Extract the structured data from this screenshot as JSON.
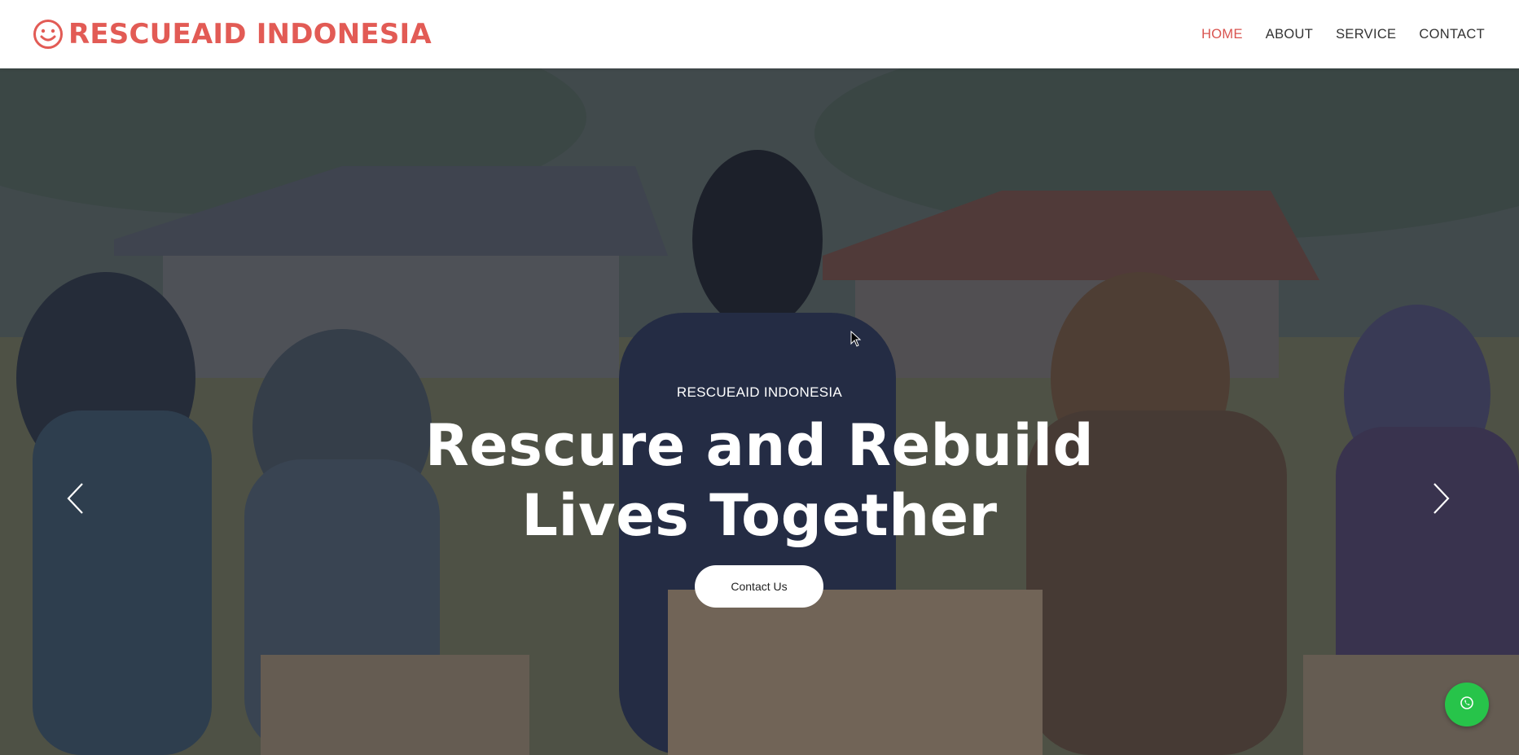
{
  "brand": {
    "name": "RESCUEAID INDONESIA",
    "icon": "smiley-icon",
    "color": "#e25b55"
  },
  "nav": {
    "items": [
      {
        "label": "HOME",
        "active": true
      },
      {
        "label": "ABOUT",
        "active": false
      },
      {
        "label": "SERVICE",
        "active": false
      },
      {
        "label": "CONTACT",
        "active": false
      }
    ],
    "active_color": "#d9534f"
  },
  "hero": {
    "kicker": "RESCUEAID INDONESIA",
    "title_line1": "Rescure and Rebuild",
    "title_line2": "Lives Together",
    "cta_label": "Contact Us",
    "prev_icon": "chevron-left-icon",
    "next_icon": "chevron-right-icon"
  },
  "floating": {
    "whatsapp_icon": "whatsapp-icon",
    "color": "#27c44a"
  }
}
